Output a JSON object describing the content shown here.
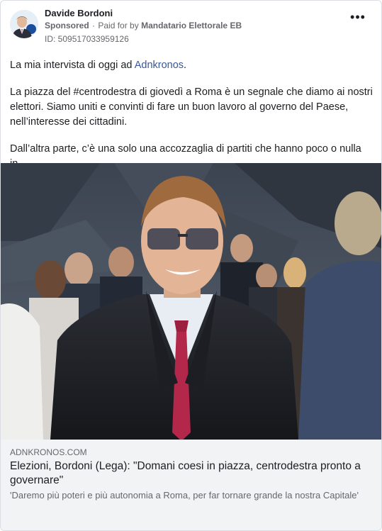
{
  "post": {
    "author": "Davide Bordoni",
    "sponsored_label": "Sponsored",
    "paid_for_prefix": "Paid for by",
    "payer": "Mandatario Elettorale EB",
    "ad_id": "ID: 509517033959126",
    "more_label": "•••",
    "paragraph_1_prefix": "La mia intervista di oggi ad ",
    "paragraph_1_link": "Adnkronos",
    "paragraph_1_suffix": ".",
    "paragraph_2": "La piazza del #centrodestra di giovedì a Roma è un segnale che diamo ai nostri elettori. Siamo uniti e convinti di fare un buon lavoro al governo del Paese, nell’interesse dei cittadini.",
    "paragraph_3": "Dall’altra parte, c’è una solo una accozzaglia di partiti che hanno poco o nulla in..."
  },
  "link_preview": {
    "domain": "ADNKRONOS.COM",
    "title": "Elezioni, Bordoni (Lega): \"Domani coesi in piazza, centrodestra pronto a governare\"",
    "description": "'Daremo più poteri e più autonomia a Roma, per far tornare grande la nostra Capitale'"
  },
  "colors": {
    "link": "#385898",
    "secondary_text": "#65676b",
    "preview_bg": "#f2f3f5"
  },
  "icons": [
    "avatar-photo",
    "globe-icon",
    "more-options-icon"
  ]
}
